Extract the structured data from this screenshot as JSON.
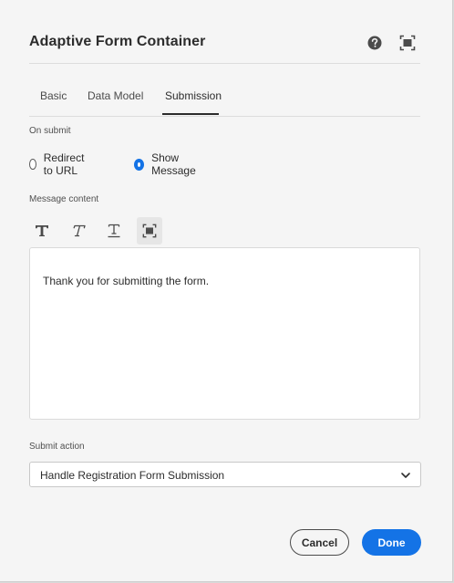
{
  "dialog": {
    "title": "Adaptive Form Container",
    "icons": {
      "help": "help-icon",
      "fullscreen": "fullscreen-icon"
    }
  },
  "tabs": [
    {
      "label": "Basic",
      "selected": false
    },
    {
      "label": "Data Model",
      "selected": false
    },
    {
      "label": "Submission",
      "selected": true
    }
  ],
  "on_submit": {
    "label": "On submit",
    "options": [
      {
        "label": "Redirect to URL",
        "checked": false
      },
      {
        "label": "Show Message",
        "checked": true
      }
    ]
  },
  "message_content": {
    "label": "Message content",
    "toolbar": [
      {
        "icon": "bold-icon"
      },
      {
        "icon": "italic-icon"
      },
      {
        "icon": "underline-icon"
      },
      {
        "icon": "fullscreen-icon",
        "active": true
      }
    ],
    "text": "Thank you for submitting the form."
  },
  "submit_action": {
    "label": "Submit action",
    "value": "Handle Registration Form Submission"
  },
  "buttons": {
    "cancel": "Cancel",
    "done": "Done"
  },
  "colors": {
    "accent": "#1473e6",
    "background": "#f5f5f5"
  }
}
